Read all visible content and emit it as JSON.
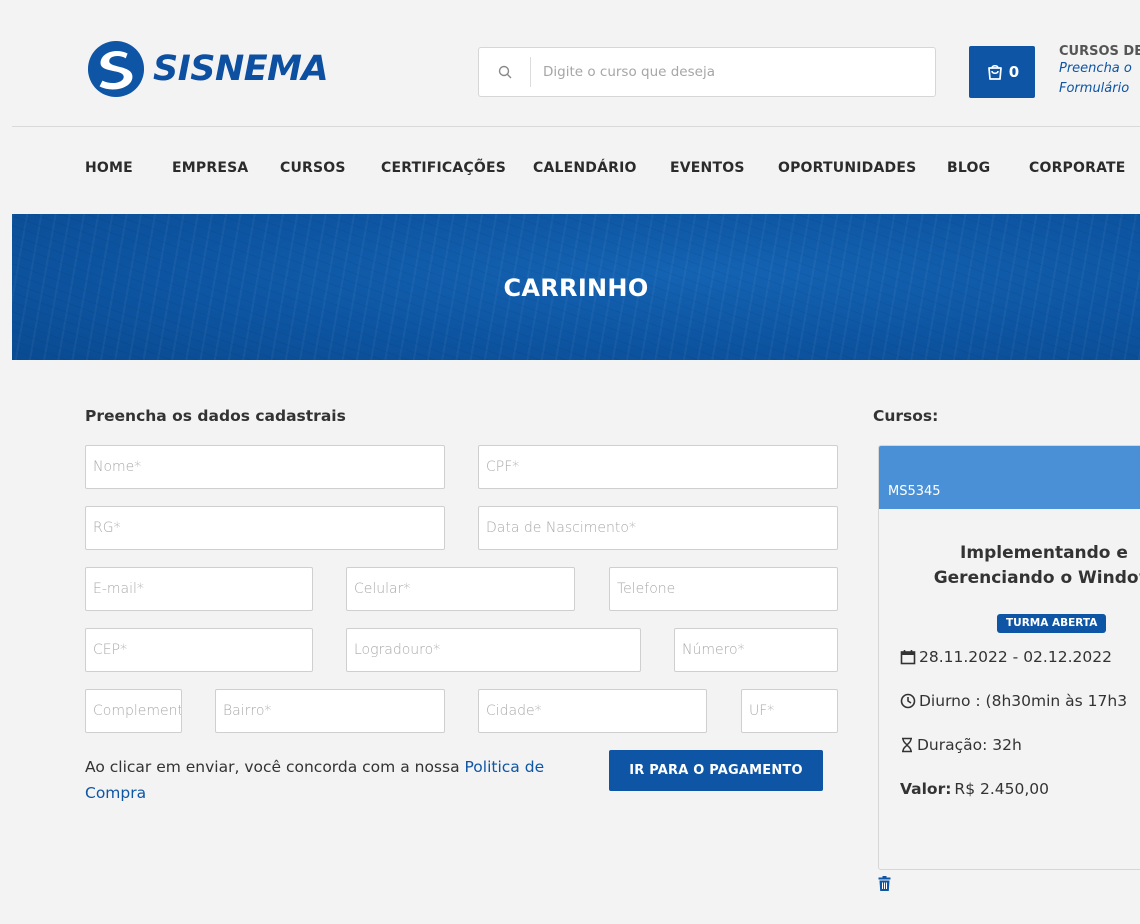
{
  "brand": {
    "name": "SISNEMA",
    "color": "#0e55a5"
  },
  "search": {
    "placeholder": "Digite o curso que deseja"
  },
  "cart": {
    "count": "0"
  },
  "promo": {
    "title": "CURSOS DE",
    "line1": "Preencha o",
    "line2": "Formulário"
  },
  "nav": [
    "HOME",
    "EMPRESA",
    "CURSOS",
    "CERTIFICAÇÕES",
    "CALENDÁRIO",
    "EVENTOS",
    "OPORTUNIDADES",
    "BLOG",
    "CORPORATE"
  ],
  "hero": {
    "title": "CARRINHO"
  },
  "form": {
    "title": "Preencha os dados cadastrais",
    "fields": {
      "nome": "Nome*",
      "cpf": "CPF*",
      "rg": "RG*",
      "nascimento": "Data de Nascimento*",
      "email": "E-mail*",
      "celular": "Celular*",
      "telefone": "Telefone",
      "cep": "CEP*",
      "logradouro": "Logradouro*",
      "numero": "Número*",
      "complemento": "Complemento",
      "bairro": "Bairro*",
      "cidade": "Cidade*",
      "uf": "UF*"
    },
    "terms_text": "Ao clicar em enviar, você concorda com a nossa",
    "terms_link": "Politica de Compra",
    "submit": "IR PARA O PAGAMENTO"
  },
  "courses": {
    "title": "Cursos:",
    "items": [
      {
        "code": "MS5345",
        "name_line1": "Implementando e",
        "name_line2": "Gerenciando o Window",
        "badge": "TURMA ABERTA",
        "dates": "28.11.2022 - 02.12.2022",
        "schedule": "Diurno : (8h30min às 17h3",
        "duration": "Duração: 32h",
        "price_label": "Valor:",
        "price": "R$ 2.450,00"
      }
    ]
  }
}
